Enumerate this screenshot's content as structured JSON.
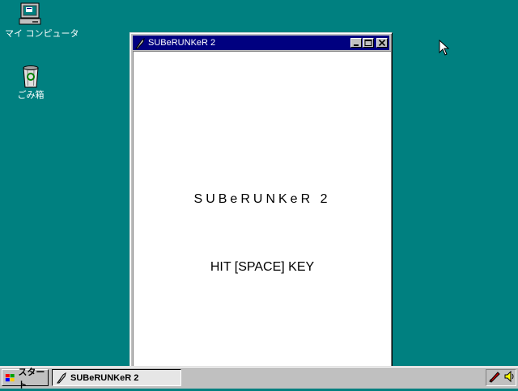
{
  "desktop": {
    "icons": [
      {
        "label": "マイ コンピュータ",
        "icon": "my-computer-icon"
      },
      {
        "label": "ごみ箱",
        "icon": "recycle-bin-icon"
      }
    ]
  },
  "window": {
    "title": "SUBeRUNKeR 2",
    "app_icon": "quill-pen-icon",
    "controls": [
      "minimize",
      "maximize",
      "close"
    ],
    "content": {
      "game_title": "SUBeRUNKeR  2",
      "prompt": "HIT [SPACE] KEY"
    }
  },
  "taskbar": {
    "start_label": "スタート",
    "tasks": [
      {
        "label": "SUBeRUNKeR 2",
        "active": true
      }
    ],
    "tray_icons": [
      "pen-input-icon",
      "volume-speaker-icon"
    ]
  },
  "colors": {
    "desktop": "#008080",
    "titlebar_active": "#000080",
    "face": "#c0c0c0"
  }
}
